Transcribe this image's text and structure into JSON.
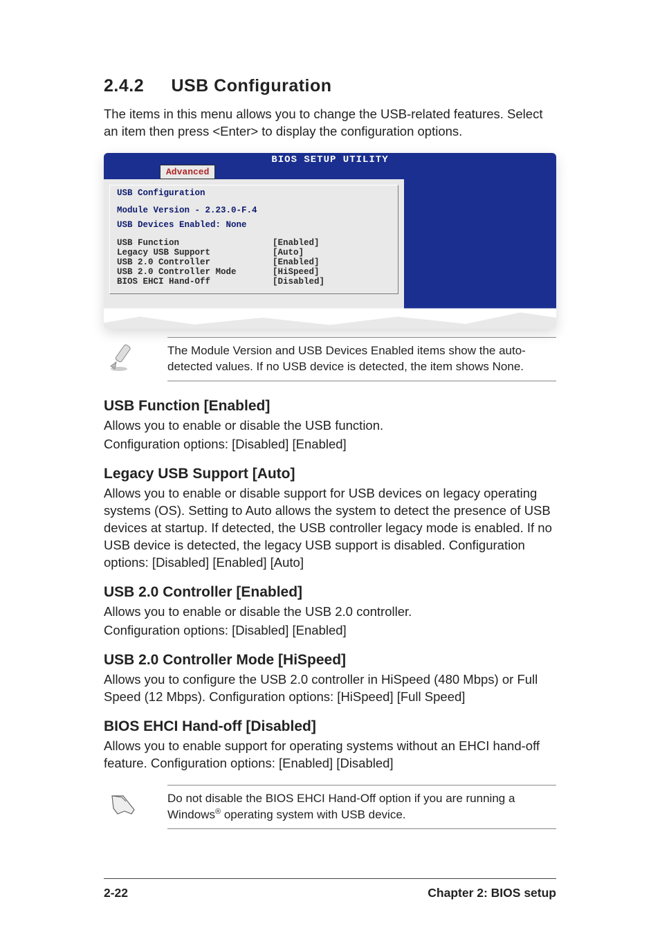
{
  "section": {
    "number": "2.4.2",
    "title": "USB Configuration",
    "intro": "The items in this menu allows you to change the USB-related features. Select an item then press <Enter> to display the configuration options."
  },
  "bios": {
    "title": "BIOS SETUP UTILITY",
    "tab": "Advanced",
    "section_title": "USB Configuration",
    "info_lines": [
      "Module Version - 2.23.0-F.4",
      "USB Devices Enabled: None"
    ],
    "rows": [
      {
        "label": "USB Function",
        "value": "[Enabled]"
      },
      {
        "label": "Legacy USB Support",
        "value": "[Auto]"
      },
      {
        "label": "USB 2.0 Controller",
        "value": "[Enabled]"
      },
      {
        "label": "USB 2.0 Controller Mode",
        "value": "[HiSpeed]"
      },
      {
        "label": "BIOS EHCI Hand-Off",
        "value": "[Disabled]"
      }
    ]
  },
  "note1": "The Module Version and USB Devices Enabled items show the auto-detected values. If no USB device is detected, the item shows None.",
  "items": [
    {
      "heading": "USB Function [Enabled]",
      "paras": [
        "Allows you to enable or disable the USB function.",
        "Configuration options: [Disabled] [Enabled]"
      ]
    },
    {
      "heading": "Legacy USB Support [Auto]",
      "paras": [
        "Allows you to enable or disable support for USB devices on legacy operating systems (OS). Setting to Auto allows the system to detect the presence of USB devices at startup. If detected, the USB controller legacy mode is enabled. If no USB device is detected, the legacy USB support is disabled. Configuration options: [Disabled] [Enabled] [Auto]"
      ]
    },
    {
      "heading": "USB 2.0 Controller [Enabled]",
      "paras": [
        "Allows you to enable or disable the USB 2.0 controller.",
        "Configuration options: [Disabled] [Enabled]"
      ]
    },
    {
      "heading": "USB 2.0 Controller Mode [HiSpeed]",
      "paras": [
        "Allows you to configure the USB 2.0 controller in HiSpeed (480 Mbps) or Full Speed (12 Mbps). Configuration options: [HiSpeed] [Full Speed]"
      ]
    },
    {
      "heading": "BIOS EHCI Hand-off [Disabled]",
      "paras": [
        "Allows you to enable support for operating systems without an EHCI hand-off feature. Configuration options: [Enabled] [Disabled]"
      ]
    }
  ],
  "note2_pre": "Do not disable the BIOS EHCI Hand-Off option if you are running a Windows",
  "note2_post": " operating system with USB device.",
  "footer": {
    "left": "2-22",
    "right": "Chapter 2: BIOS setup"
  }
}
